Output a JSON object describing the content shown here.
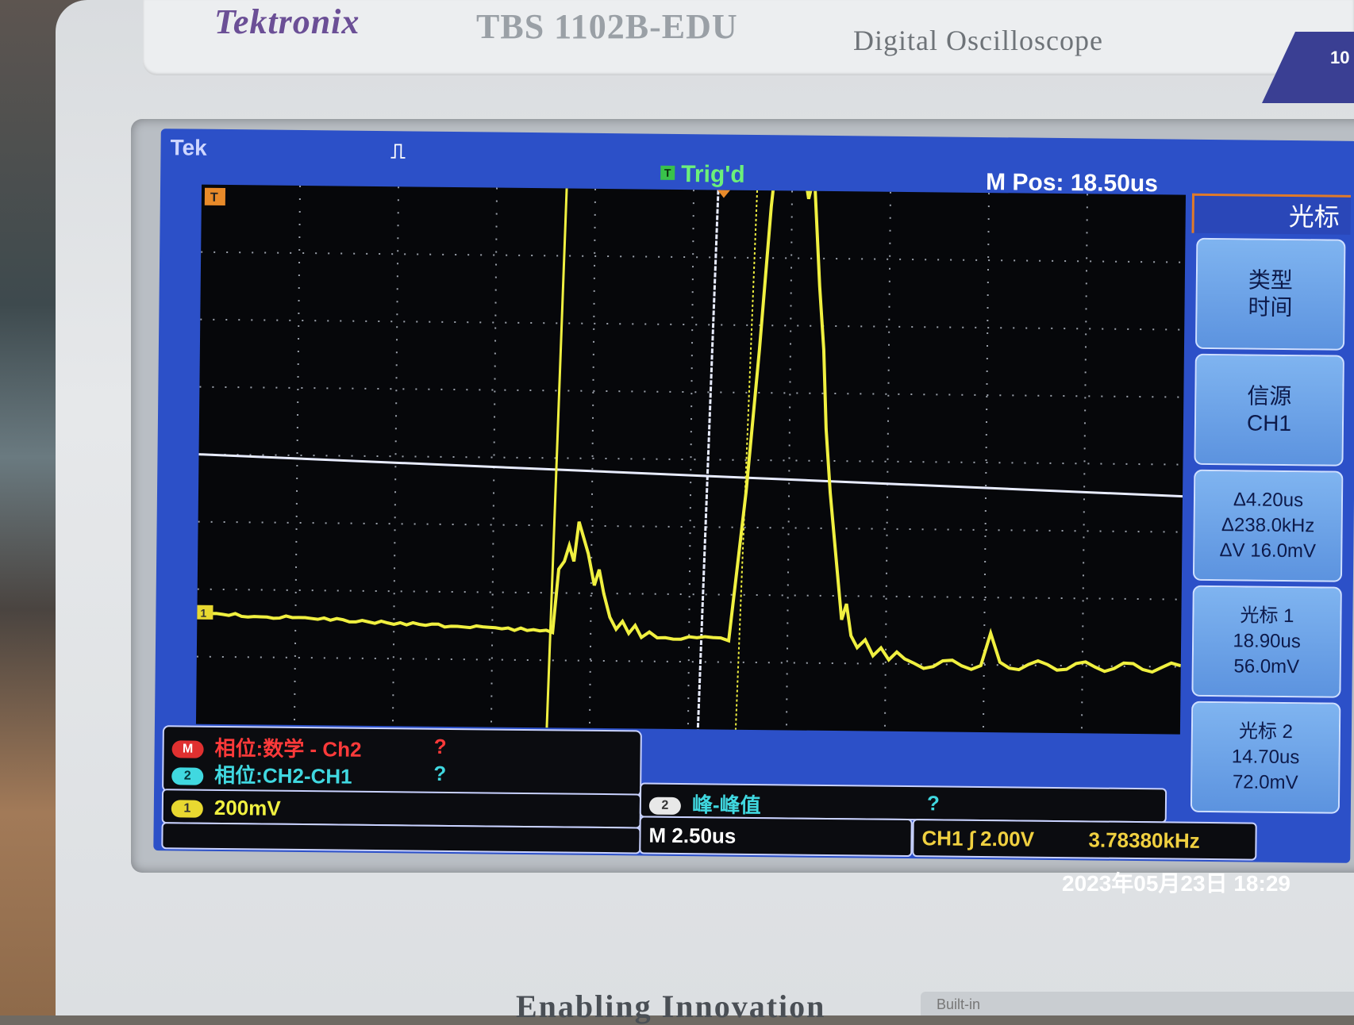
{
  "instrument": {
    "brand": "Tektronix",
    "model": "TBS 1102B-EDU",
    "model_desc": "Digital Oscilloscope",
    "badge": "10",
    "bottom_label": "Enabling Innovation",
    "bottom_plate": "Built-in"
  },
  "status_bar": {
    "tek": "Tek",
    "acq_icon": "⎍",
    "trig_badge": "T",
    "trig_status": "Trig'd",
    "m_pos": "M Pos: 18.50us"
  },
  "markers": {
    "trigger_pos": "T",
    "ch1_ground": "1"
  },
  "menu": {
    "title": "光标",
    "buttons": [
      {
        "line1": "类型",
        "line2": "时间",
        "line3": ""
      },
      {
        "line1": "信源",
        "line2": "CH1",
        "line3": ""
      },
      {
        "line1": "Δ4.20us",
        "line2": "Δ238.0kHz",
        "line3": "ΔV 16.0mV"
      },
      {
        "line1": "光标 1",
        "line2": "18.90us",
        "line3": "56.0mV"
      },
      {
        "line1": "光标 2",
        "line2": "14.70us",
        "line3": "72.0mV"
      }
    ]
  },
  "measurements": [
    {
      "badge": "M",
      "label": "相位:数学 - Ch2",
      "value": "?",
      "color": "#ff3a3a"
    },
    {
      "badge": "2",
      "label": "相位:CH2-CH1",
      "value": "?",
      "color": "#40d8e0"
    }
  ],
  "ch1_scale": {
    "badge": "1",
    "value": "200mV"
  },
  "peak_peak": {
    "badge": "2",
    "label": "峰-峰值",
    "value": "?"
  },
  "timebase": "M 2.50us",
  "trigger_info": {
    "source": "CH1 ∫ 2.00V",
    "freq": "3.78380kHz"
  },
  "datetime": "2023年05月23日 18:29",
  "colors": {
    "trace": "#f0f040",
    "screen_bg": "#2c50c8",
    "grid": "#9aa0aa",
    "cursor": "#ffffff"
  }
}
